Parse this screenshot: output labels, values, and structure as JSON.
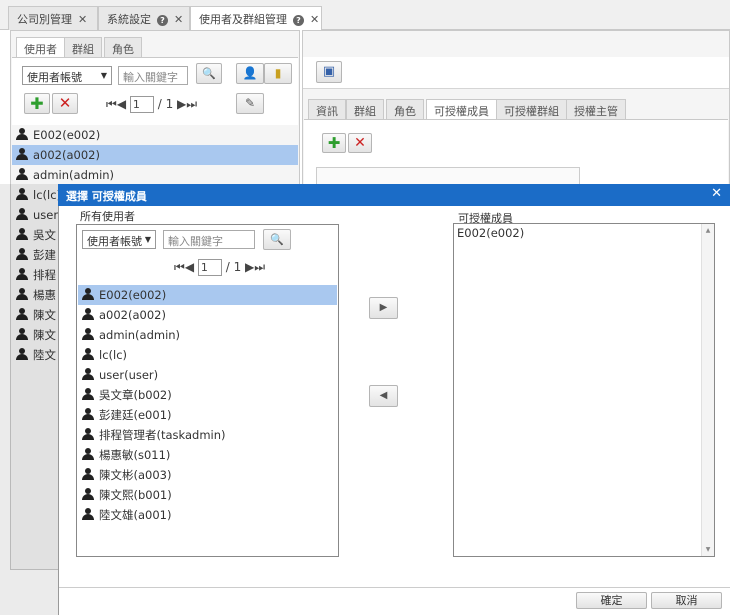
{
  "top_tabs": [
    {
      "label": "公司別管理",
      "icon": "close-icon"
    },
    {
      "label": "系統設定",
      "icon": "help-icon"
    },
    {
      "label": "使用者及群組管理",
      "icon": "help-icon"
    }
  ],
  "left_tabs": [
    "使用者",
    "群組",
    "角色"
  ],
  "left_search": {
    "select": "使用者帳號",
    "placeholder": "輸入關鍵字"
  },
  "left_pager": {
    "page": "1",
    "sep": "/",
    "total": "1"
  },
  "left_users": [
    "E002(e002)",
    "a002(a002)",
    "admin(admin)",
    "lc(lc)",
    "user",
    "吳文",
    "彭建",
    "排程",
    "楊惠",
    "陳文",
    "陳文",
    "陸文"
  ],
  "right_tabs": [
    "資訊",
    "群組",
    "角色",
    "可授權成員",
    "可授權群組",
    "授權主管"
  ],
  "dialog": {
    "title": "選擇 可授權成員",
    "all_users_label": "所有使用者",
    "authorized_label": "可授權成員",
    "select": "使用者帳號",
    "placeholder": "輸入關鍵字",
    "pager": {
      "page": "1",
      "sep": "/",
      "total": "1"
    },
    "users": [
      "E002(e002)",
      "a002(a002)",
      "admin(admin)",
      "lc(lc)",
      "user(user)",
      "吳文章(b002)",
      "彭建廷(e001)",
      "排程管理者(taskadmin)",
      "楊惠敏(s011)",
      "陳文彬(a003)",
      "陳文熙(b001)",
      "陸文雄(a001)"
    ],
    "authorized": [
      "E002(e002)"
    ],
    "confirm": "確定",
    "cancel": "取消"
  }
}
